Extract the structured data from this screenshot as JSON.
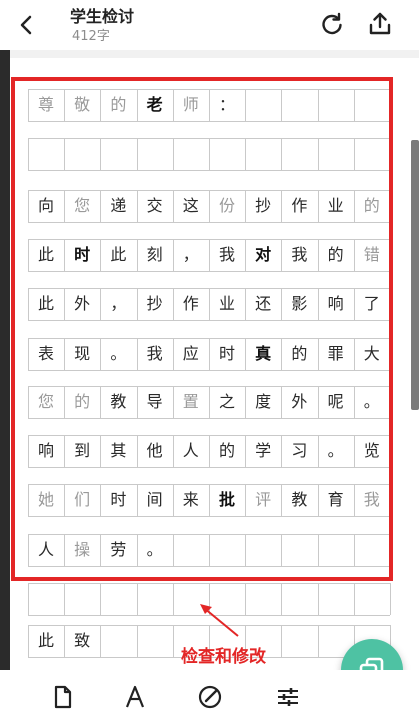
{
  "header": {
    "title": "学生检讨",
    "word_count": "412字",
    "icons": [
      "back-arrow-icon",
      "refresh-icon",
      "share-upload-icon"
    ]
  },
  "essay": {
    "rows": [
      [
        "尊",
        "敬",
        "的",
        "老",
        "师",
        "：",
        "",
        "",
        "",
        ""
      ],
      [
        "",
        "",
        "",
        "",
        "",
        "",
        "",
        "",
        "",
        ""
      ],
      [
        "向",
        "您",
        "递",
        "交",
        "这",
        "份",
        "抄",
        "作",
        "业",
        "的"
      ],
      [
        "此",
        "时",
        "此",
        "刻",
        "，",
        "我",
        "对",
        "我",
        "的",
        "错"
      ],
      [
        "此",
        "外",
        "，",
        "抄",
        "作",
        "业",
        "还",
        "影",
        "响",
        "了"
      ],
      [
        "表",
        "现",
        "。",
        "我",
        "应",
        "时",
        "真",
        "的",
        "罪",
        "大"
      ],
      [
        "您",
        "的",
        "教",
        "导",
        "置",
        "之",
        "度",
        "外",
        "呢",
        "。"
      ],
      [
        "响",
        "到",
        "其",
        "他",
        "人",
        "的",
        "学",
        "习",
        "。",
        "览"
      ],
      [
        "她",
        "们",
        "时",
        "间",
        "来",
        "批",
        "评",
        "教",
        "育",
        "我"
      ],
      [
        "人",
        "操",
        "劳",
        "。",
        "",
        "",
        "",
        "",
        "",
        ""
      ],
      [
        "",
        "",
        "",
        "",
        "",
        "",
        "",
        "",
        "",
        ""
      ],
      [
        "此",
        "致",
        "",
        "",
        "",
        "",
        "",
        "",
        "",
        ""
      ]
    ],
    "light_cells": [
      "0-0",
      "0-1",
      "0-2",
      "0-4",
      "2-1",
      "2-5",
      "2-9",
      "3-9",
      "6-0",
      "6-1",
      "6-4",
      "8-0",
      "8-1",
      "8-6",
      "8-9",
      "9-1"
    ],
    "bold_cells": [
      "0-3",
      "3-1",
      "3-6",
      "5-6",
      "8-5"
    ]
  },
  "annotation": {
    "label": "检查和修改",
    "color": "#e32626"
  },
  "toolbar": {
    "icons": [
      "document-icon",
      "font-icon",
      "edit-check-icon",
      "settings-sliders-icon"
    ]
  },
  "fab": {
    "icon": "copy-icon",
    "color": "#4ec2a3"
  }
}
